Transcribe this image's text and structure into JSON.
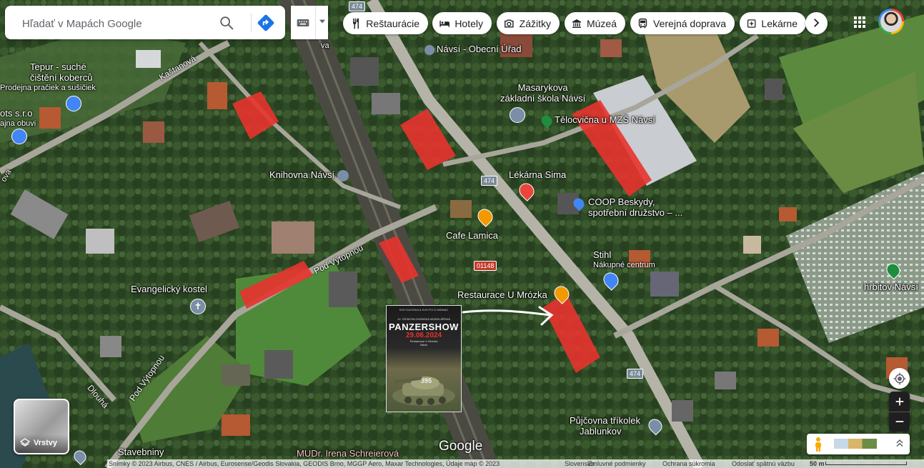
{
  "search": {
    "placeholder": "Hľadať v Mapách Google"
  },
  "categories": [
    {
      "label": "Reštaurácie",
      "icon": "fork-knife-icon"
    },
    {
      "label": "Hotely",
      "icon": "bed-icon"
    },
    {
      "label": "Zážitky",
      "icon": "camera-icon"
    },
    {
      "label": "Múzeá",
      "icon": "museum-icon"
    },
    {
      "label": "Verejná doprava",
      "icon": "bus-icon"
    },
    {
      "label": "Lekárne",
      "icon": "pharmacy-icon"
    }
  ],
  "places": {
    "obecni_urad": "Návsí - Obecní Úřad",
    "tepur_1": "Tepur - suché",
    "tepur_2": "čištění koberců",
    "tepur_3": "Prodejna pračiek a sušičiek",
    "kastanova": "Kaštanová",
    "ots_1": "ots s.r.o",
    "ots_2": "ajna obuvi",
    "skola_1": "Masarykova",
    "skola_2": "základní škola Návsí",
    "telocvicna": "Tělocvična u MZŠ Návsí",
    "knihovna": "Knihovna Návsí",
    "lekarna": "Lékárna Sima",
    "coop_1": "COOP Beskydy,",
    "coop_2": "spotřební družstvo – ...",
    "cafe": "Cafe Lamica",
    "pod_vytopnou": "Pod Výtopnou",
    "pod_vytopnou_2": "Pod Výtopnou",
    "stihl_1": "Stihl",
    "stihl_2": "Nákupné centrum",
    "evangelicky": "Evangelický kostel",
    "restaurace": "Restaurace U Mrózka",
    "hrbitov": "hřbitov Návsí",
    "dlouha": "Dlouhá",
    "pujcovna_1": "Půjčovna tříkolek",
    "pujcovna_2": "Jablunkov",
    "stavebniny": "Stavebniny",
    "mudr": "MUDr. Irena Schreierová",
    "ova": "ova",
    "iva": "va"
  },
  "roads": {
    "r474_a": "474",
    "r474_b": "474",
    "r474_c": "474",
    "r01148": "01148"
  },
  "poster": {
    "top": "KVH SLEZSKA & KVH P.O.D MINNAC",
    "sub": "12. ČESKOSLOVENSKÁ MODELÁŘSKÁ",
    "title": "PANZERSHOW",
    "date": "29.06.2024",
    "venue_1": "Restaurace U Mrózka",
    "venue_2": "Návsí",
    "tank_num": "395"
  },
  "layers_label": "Vrstvy",
  "google_logo": "Google",
  "footer": {
    "attribution": "Snímky © 2023 Airbus, CNES / Airbus, Eurosense/Geodis Slovakia, GEODIS Brno, MGGP Aero, Maxar Technologies, Údaje máp © 2023",
    "country": "Slovensko",
    "terms": "Zmluvné podmienky",
    "privacy": "Ochrana súkromia",
    "feedback": "Odoslať spätnú väzbu",
    "scale": "50 m"
  },
  "colors": {
    "highlight": "#e8332d",
    "accent": "#1a73e8"
  }
}
